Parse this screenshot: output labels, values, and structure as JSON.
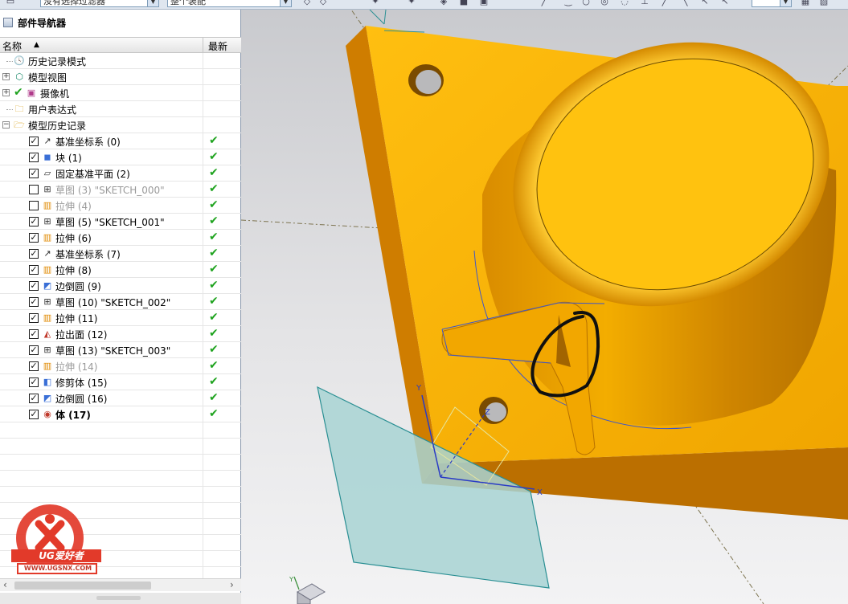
{
  "toolbar": {
    "filter_combo": "没有选择过滤器",
    "scope_combo": "整个装配"
  },
  "navigator": {
    "title": "部件导航器",
    "columns": {
      "name": "名称",
      "latest": "最新"
    },
    "top_nodes": [
      {
        "label": "历史记录模式"
      },
      {
        "label": "模型视图"
      },
      {
        "label": "摄像机"
      },
      {
        "label": "用户表达式"
      },
      {
        "label": "模型历史记录"
      }
    ],
    "features": [
      {
        "label": "基准坐标系 (0)",
        "checked": true,
        "gray": false,
        "icon": "datum-csys-icon"
      },
      {
        "label": "块 (1)",
        "checked": true,
        "gray": false,
        "icon": "block-icon"
      },
      {
        "label": "固定基准平面 (2)",
        "checked": true,
        "gray": false,
        "icon": "datum-plane-icon"
      },
      {
        "label": "草图 (3) \"SKETCH_000\"",
        "checked": false,
        "gray": true,
        "icon": "sketch-icon"
      },
      {
        "label": "拉伸 (4)",
        "checked": false,
        "gray": true,
        "icon": "extrude-icon"
      },
      {
        "label": "草图 (5) \"SKETCH_001\"",
        "checked": true,
        "gray": false,
        "icon": "sketch-icon"
      },
      {
        "label": "拉伸 (6)",
        "checked": true,
        "gray": false,
        "icon": "extrude-icon"
      },
      {
        "label": "基准坐标系 (7)",
        "checked": true,
        "gray": false,
        "icon": "datum-csys-icon"
      },
      {
        "label": "拉伸 (8)",
        "checked": true,
        "gray": false,
        "icon": "extrude-icon"
      },
      {
        "label": "边倒圆 (9)",
        "checked": true,
        "gray": false,
        "icon": "edge-blend-icon"
      },
      {
        "label": "草图 (10) \"SKETCH_002\"",
        "checked": true,
        "gray": false,
        "icon": "sketch-icon"
      },
      {
        "label": "拉伸 (11)",
        "checked": true,
        "gray": false,
        "icon": "extrude-icon"
      },
      {
        "label": "拉出面 (12)",
        "checked": true,
        "gray": false,
        "icon": "extract-face-icon"
      },
      {
        "label": "草图 (13) \"SKETCH_003\"",
        "checked": true,
        "gray": false,
        "icon": "sketch-icon"
      },
      {
        "label": "拉伸 (14)",
        "checked": true,
        "gray": true,
        "icon": "extrude-icon"
      },
      {
        "label": "修剪体 (15)",
        "checked": true,
        "gray": false,
        "icon": "trim-body-icon"
      },
      {
        "label": "边倒圆 (16)",
        "checked": true,
        "gray": false,
        "icon": "edge-blend-icon"
      },
      {
        "label": "体 (17)",
        "checked": true,
        "gray": false,
        "icon": "body-icon",
        "bold": true
      }
    ],
    "latest_mark": "✔"
  },
  "watermark": {
    "brand": "UG爱好者",
    "url": "WWW.UGSNX.COM"
  },
  "colors": {
    "part": "#f7b500",
    "part_dark": "#c98200",
    "datum_plane": "#a8d3d3",
    "latest_check": "#1fa31f"
  }
}
